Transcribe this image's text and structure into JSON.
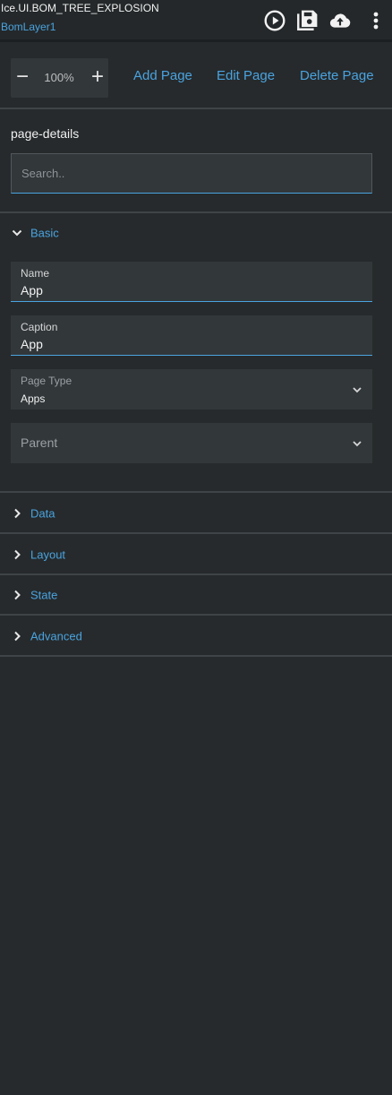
{
  "header": {
    "title": "Ice.UI.BOM_TREE_EXPLOSION",
    "subtitle": "BomLayer1",
    "icons": [
      "play-circle-icon",
      "save-icon",
      "cloud-upload-icon",
      "more-vertical-icon"
    ]
  },
  "toolbar": {
    "zoom_minus": "−",
    "zoom_value": "100%",
    "zoom_plus": "+",
    "add_page": "Add Page",
    "edit_page": "Edit Page",
    "delete_page": "Delete Page"
  },
  "details": {
    "title": "page-details",
    "search_placeholder": "Search.."
  },
  "groups": {
    "basic": "Basic",
    "data": "Data",
    "layout": "Layout",
    "state": "State",
    "advanced": "Advanced"
  },
  "basic": {
    "name_label": "Name",
    "name_value": "App",
    "caption_label": "Caption",
    "caption_value": "App",
    "page_type_label": "Page Type",
    "page_type_value": "Apps",
    "parent_label": "Parent"
  },
  "colors": {
    "accent": "#4aa3df",
    "background": "#262a2c",
    "field": "#32373a"
  }
}
